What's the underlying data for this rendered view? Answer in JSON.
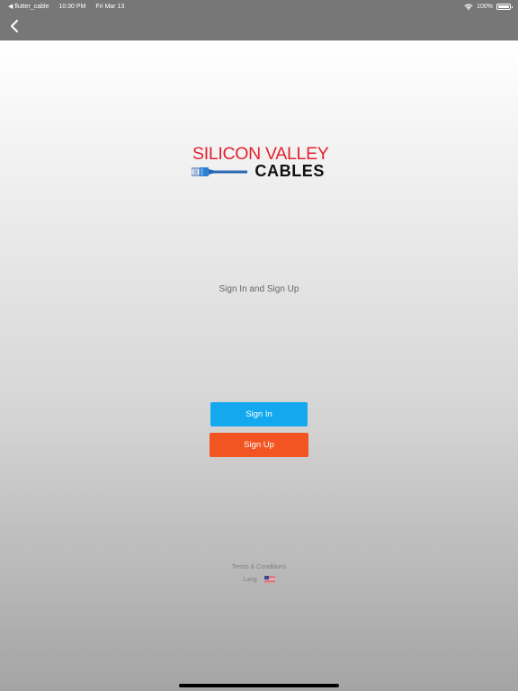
{
  "status_bar": {
    "back_app": "◀ flutter_cable",
    "time": "10:30 PM",
    "date": "Fri Mar 13",
    "battery": "100%"
  },
  "nav": {
    "back_icon": "chevron-left-icon"
  },
  "logo": {
    "line1": "SILICON VALLEY",
    "line2": "CABLES"
  },
  "main": {
    "subtitle": "Sign In and Sign Up",
    "sign_in_label": "Sign In",
    "sign_up_label": "Sign Up"
  },
  "footer": {
    "terms": "Terms & Conditions",
    "lang_label": "Lang",
    "lang_flag_icon": "us-flag-icon"
  },
  "colors": {
    "top_bar": "#777777",
    "sign_in": "#14a9ef",
    "sign_up": "#f25422",
    "logo_red": "#e2222e",
    "logo_black": "#111111"
  }
}
